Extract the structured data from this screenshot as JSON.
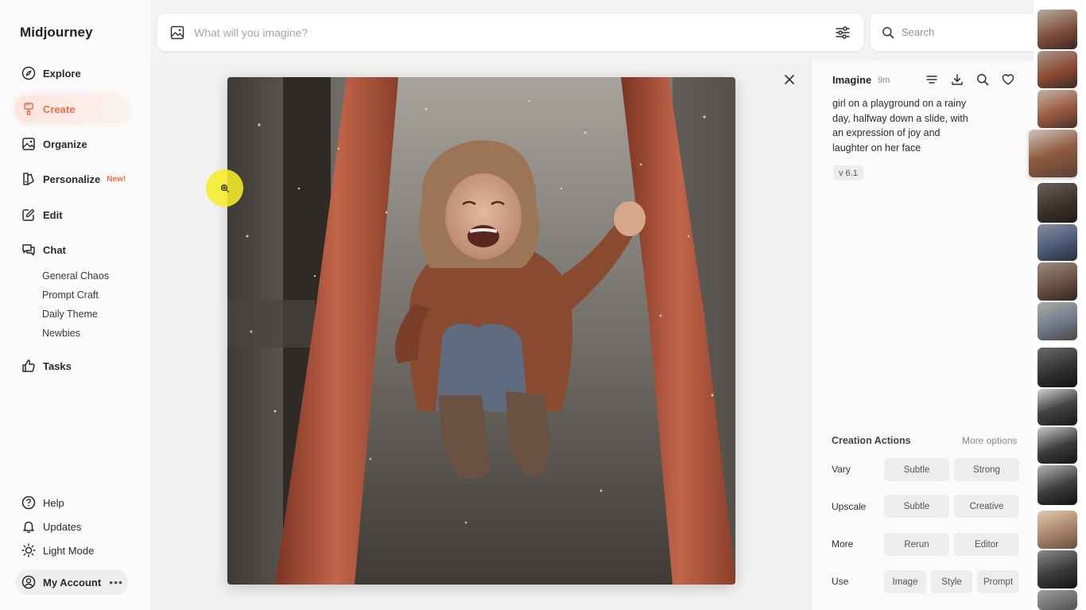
{
  "app": {
    "name": "Midjourney"
  },
  "sidebar": {
    "items": [
      {
        "label": "Explore",
        "icon": "compass-icon"
      },
      {
        "label": "Create",
        "icon": "brush-icon",
        "active": true
      },
      {
        "label": "Organize",
        "icon": "image-icon"
      },
      {
        "label": "Personalize",
        "icon": "palette-icon",
        "badge": "New!"
      },
      {
        "label": "Edit",
        "icon": "edit-icon"
      },
      {
        "label": "Chat",
        "icon": "chat-icon"
      }
    ],
    "chat_rooms": [
      "General Chaos",
      "Prompt Craft",
      "Daily Theme",
      "Newbies"
    ],
    "tasks_label": "Tasks",
    "bottom": [
      {
        "label": "Help",
        "icon": "help-icon"
      },
      {
        "label": "Updates",
        "icon": "bell-icon"
      },
      {
        "label": "Light Mode",
        "icon": "sun-icon"
      }
    ],
    "account_label": "My Account"
  },
  "prompt_bar": {
    "placeholder": "What will you imagine?"
  },
  "search": {
    "placeholder": "Search"
  },
  "details": {
    "title": "Imagine",
    "time": "9m",
    "prompt": "girl on a playground on a rainy day, halfway down a slide, with an expression of joy and laughter on her face",
    "version": "v 6.1"
  },
  "creation_actions": {
    "title": "Creation Actions",
    "more_options": "More options",
    "rows": [
      {
        "label": "Vary",
        "buttons": [
          "Subtle",
          "Strong"
        ]
      },
      {
        "label": "Upscale",
        "buttons": [
          "Subtle",
          "Creative"
        ]
      },
      {
        "label": "More",
        "buttons": [
          "Rerun",
          "Editor"
        ]
      },
      {
        "label": "Use",
        "buttons": [
          "Image",
          "Style",
          "Prompt"
        ]
      }
    ]
  },
  "colors": {
    "accent": "#ee6a4a",
    "cursor_highlight": "#f8ec28"
  }
}
